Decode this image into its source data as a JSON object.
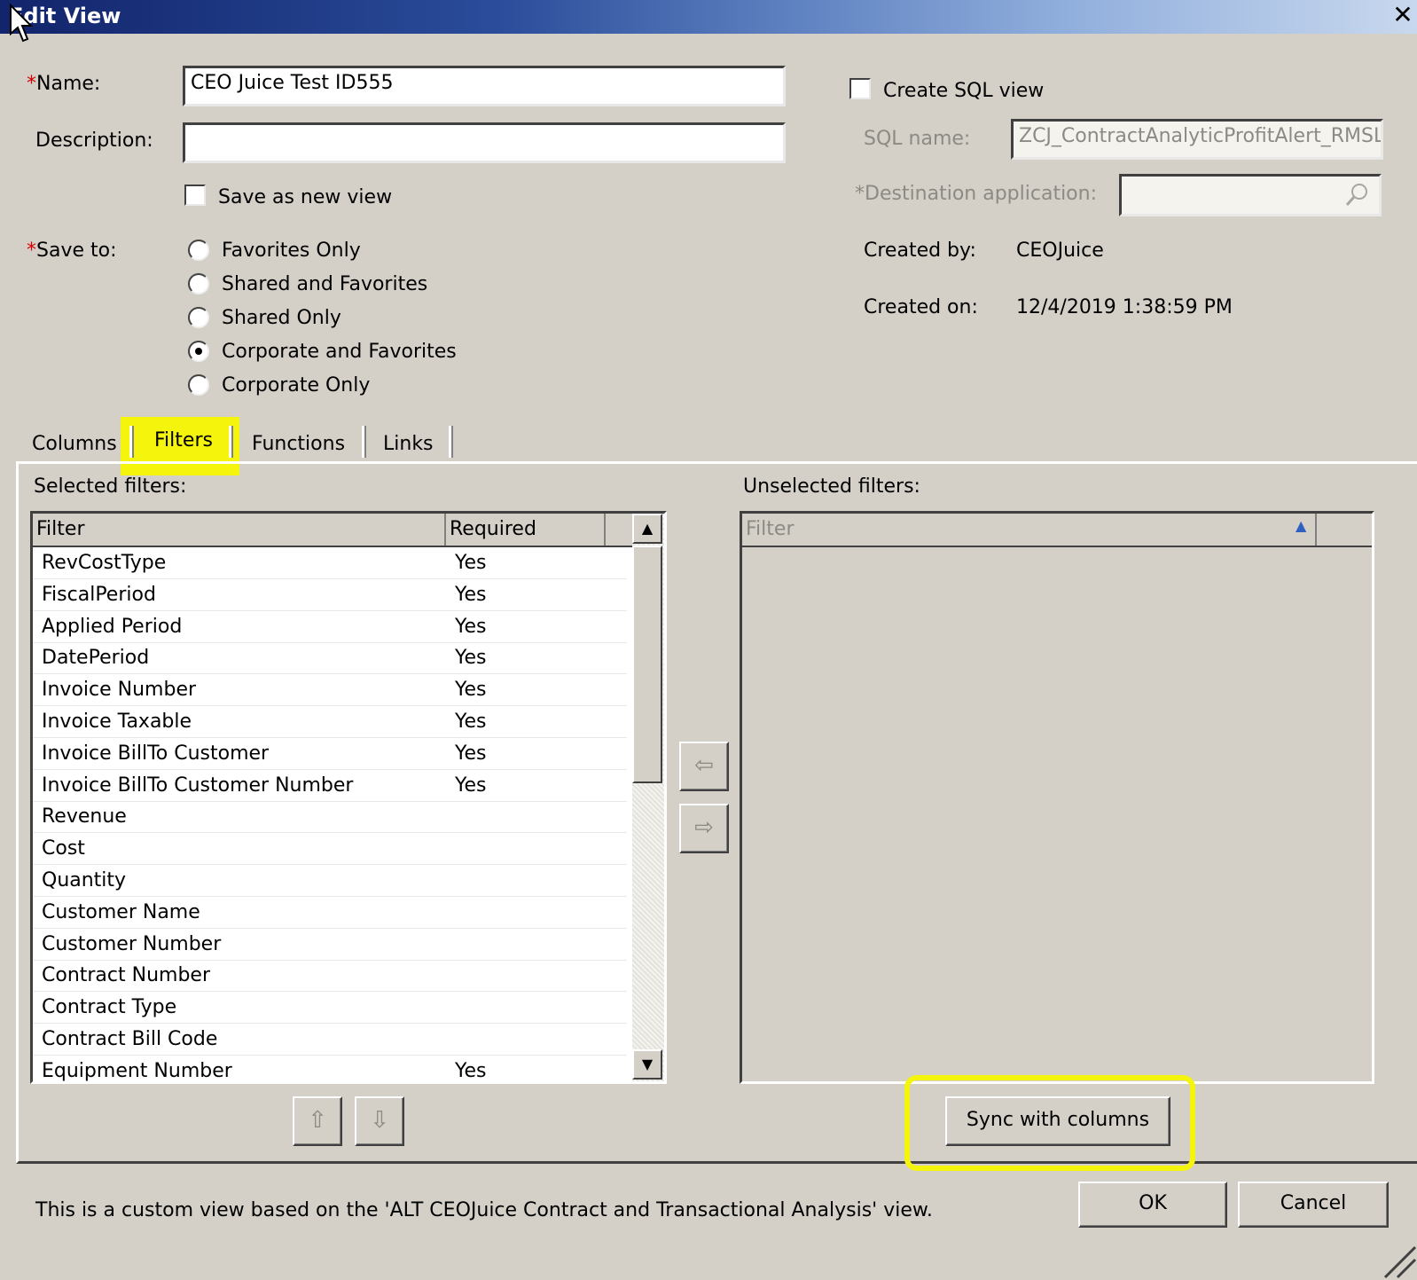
{
  "window": {
    "title": "Edit View",
    "close_glyph": "✕"
  },
  "form": {
    "name_label": "Name:",
    "name_value": "CEO Juice Test ID555",
    "description_label": "Description:",
    "description_value": "",
    "save_as_new_label": "Save as new view",
    "save_to_label": "Save to:",
    "save_to_options": [
      {
        "label": "Favorites Only",
        "selected": false
      },
      {
        "label": "Shared and Favorites",
        "selected": false
      },
      {
        "label": "Shared Only",
        "selected": false
      },
      {
        "label": "Corporate and Favorites",
        "selected": true
      },
      {
        "label": "Corporate Only",
        "selected": false
      }
    ]
  },
  "sql": {
    "create_label": "Create SQL view",
    "sql_name_label": "SQL name:",
    "sql_name_value": "ZCJ_ContractAnalyticProfitAlert_RMSL",
    "destination_label": "*Destination application:",
    "destination_value": ""
  },
  "meta": {
    "created_by_label": "Created by:",
    "created_by_value": "CEOJuice",
    "created_on_label": "Created on:",
    "created_on_value": "12/4/2019 1:38:59 PM"
  },
  "tabs": [
    {
      "label": "Columns",
      "active": false
    },
    {
      "label": "Filters",
      "active": true
    },
    {
      "label": "Functions",
      "active": false
    },
    {
      "label": "Links",
      "active": false
    }
  ],
  "selected_filters": {
    "label": "Selected filters:",
    "columns": [
      "Filter",
      "Required"
    ],
    "rows": [
      {
        "filter": "RevCostType",
        "required": "Yes"
      },
      {
        "filter": "FiscalPeriod",
        "required": "Yes"
      },
      {
        "filter": "Applied Period",
        "required": "Yes"
      },
      {
        "filter": "DatePeriod",
        "required": "Yes"
      },
      {
        "filter": "Invoice Number",
        "required": "Yes"
      },
      {
        "filter": "Invoice Taxable",
        "required": "Yes"
      },
      {
        "filter": "Invoice BillTo Customer",
        "required": "Yes"
      },
      {
        "filter": "Invoice BillTo Customer Number",
        "required": "Yes"
      },
      {
        "filter": "Revenue",
        "required": ""
      },
      {
        "filter": "Cost",
        "required": ""
      },
      {
        "filter": "Quantity",
        "required": ""
      },
      {
        "filter": "Customer Name",
        "required": ""
      },
      {
        "filter": "Customer Number",
        "required": ""
      },
      {
        "filter": "Contract Number",
        "required": ""
      },
      {
        "filter": "Contract Type",
        "required": ""
      },
      {
        "filter": "Contract Bill Code",
        "required": ""
      },
      {
        "filter": "Equipment Number",
        "required": "Yes"
      }
    ]
  },
  "unselected_filters": {
    "label": "Unselected filters:",
    "columns": [
      "Filter"
    ]
  },
  "icons": {
    "move_left": "⇦",
    "move_right": "⇨",
    "move_up": "⇧",
    "move_down": "⇩",
    "scroll_up": "▲",
    "scroll_down": "▼",
    "sort_asc": "▲"
  },
  "buttons": {
    "sync": "Sync with columns",
    "ok": "OK",
    "cancel": "Cancel"
  },
  "footer_text": "This is a custom view based on the 'ALT CEOJuice Contract and Transactional Analysis' view.",
  "colors": {
    "highlight": "#f4f40c",
    "titlebar": "#12246b",
    "dialog": "#d4d0c8"
  }
}
